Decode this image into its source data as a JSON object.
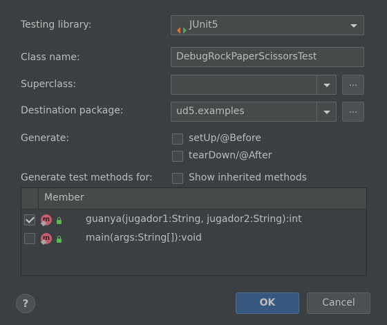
{
  "form": {
    "testing_library_label": "Testing library:",
    "testing_library_value": "JUnit5",
    "class_name_label": "Class name:",
    "class_name_value": "DebugRockPaperScissorsTest",
    "superclass_label": "Superclass:",
    "superclass_value": "",
    "superclass_browse": "...",
    "destination_label": "Destination package:",
    "destination_value": "ud5.examples",
    "destination_browse": "...",
    "generate_label": "Generate:",
    "setup_label": "setUp/@Before",
    "setup_checked": false,
    "teardown_label": "tearDown/@After",
    "teardown_checked": false,
    "methods_for_label": "Generate test methods for:",
    "show_inherited_label": "Show inherited methods",
    "show_inherited_checked": false
  },
  "table": {
    "column_header": "Member",
    "rows": [
      {
        "icon_letter": "m",
        "signature": "guanya(jugador1:String, jugador2:String):int",
        "checked": true
      },
      {
        "icon_letter": "m",
        "signature": "main(args:String[]):void",
        "checked": false
      }
    ]
  },
  "footer": {
    "help_label": "?",
    "ok_label": "OK",
    "cancel_label": "Cancel"
  },
  "icons": {
    "junit": "junit-icon",
    "method": "method-icon",
    "lock": "lock-icon",
    "pin": "pin-icon",
    "dropdown": "chevron-down-icon",
    "help": "help-icon"
  },
  "colors": {
    "background": "#3c3f41",
    "ok_button": "#365880",
    "method_icon": "#c75c6e",
    "lock_icon": "#5fb455",
    "junit_left": "#e0703c",
    "junit_right": "#58a55c"
  }
}
